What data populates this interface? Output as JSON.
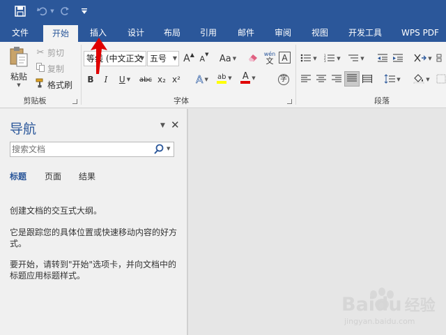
{
  "quick_access": {
    "save_icon": "save-icon",
    "undo_icon": "undo-icon",
    "redo_icon": "redo-icon",
    "customize_icon": "customize-icon"
  },
  "tabs": [
    {
      "label": "文件"
    },
    {
      "label": "开始"
    },
    {
      "label": "插入"
    },
    {
      "label": "设计"
    },
    {
      "label": "布局"
    },
    {
      "label": "引用"
    },
    {
      "label": "邮件"
    },
    {
      "label": "审阅"
    },
    {
      "label": "视图"
    },
    {
      "label": "开发工具"
    },
    {
      "label": "WPS PDF"
    }
  ],
  "clipboard": {
    "paste_label": "粘贴",
    "cut_label": "剪切",
    "copy_label": "复制",
    "format_painter_label": "格式刷",
    "group_label": "剪贴板"
  },
  "font": {
    "font_name": "等线 (中文正文",
    "font_size": "五号",
    "group_label": "字体",
    "btn_grow": "A",
    "btn_shrink": "A",
    "btn_case": "Aa",
    "btn_pinyin_top": "wén",
    "btn_pinyin_bottom": "文",
    "btn_border": "A",
    "bold": "B",
    "italic": "I",
    "underline": "U",
    "strike": "abc",
    "subscript": "x₂",
    "superscript": "x²",
    "text_effect": "A",
    "highlight": "ab",
    "font_color": "A",
    "enclose": "字"
  },
  "paragraph": {
    "group_label": "段落"
  },
  "colors": {
    "brand": "#2b579a",
    "highlight": "#ffff00",
    "font_color": "#e00000",
    "arrow": "#e00000"
  },
  "nav": {
    "title": "导航",
    "search_placeholder": "搜索文档",
    "tabs": [
      "标题",
      "页面",
      "结果"
    ],
    "desc1": "创建文档的交互式大纲。",
    "desc2": "它是跟踪您的具体位置或快速移动内容的好方式。",
    "desc3": "要开始，请转到\"开始\"选项卡，并向文档中的标题应用标题样式。"
  },
  "watermark": {
    "brand": "Baidu",
    "brand_cn": "经验",
    "url": "jingyan.baidu.com"
  }
}
